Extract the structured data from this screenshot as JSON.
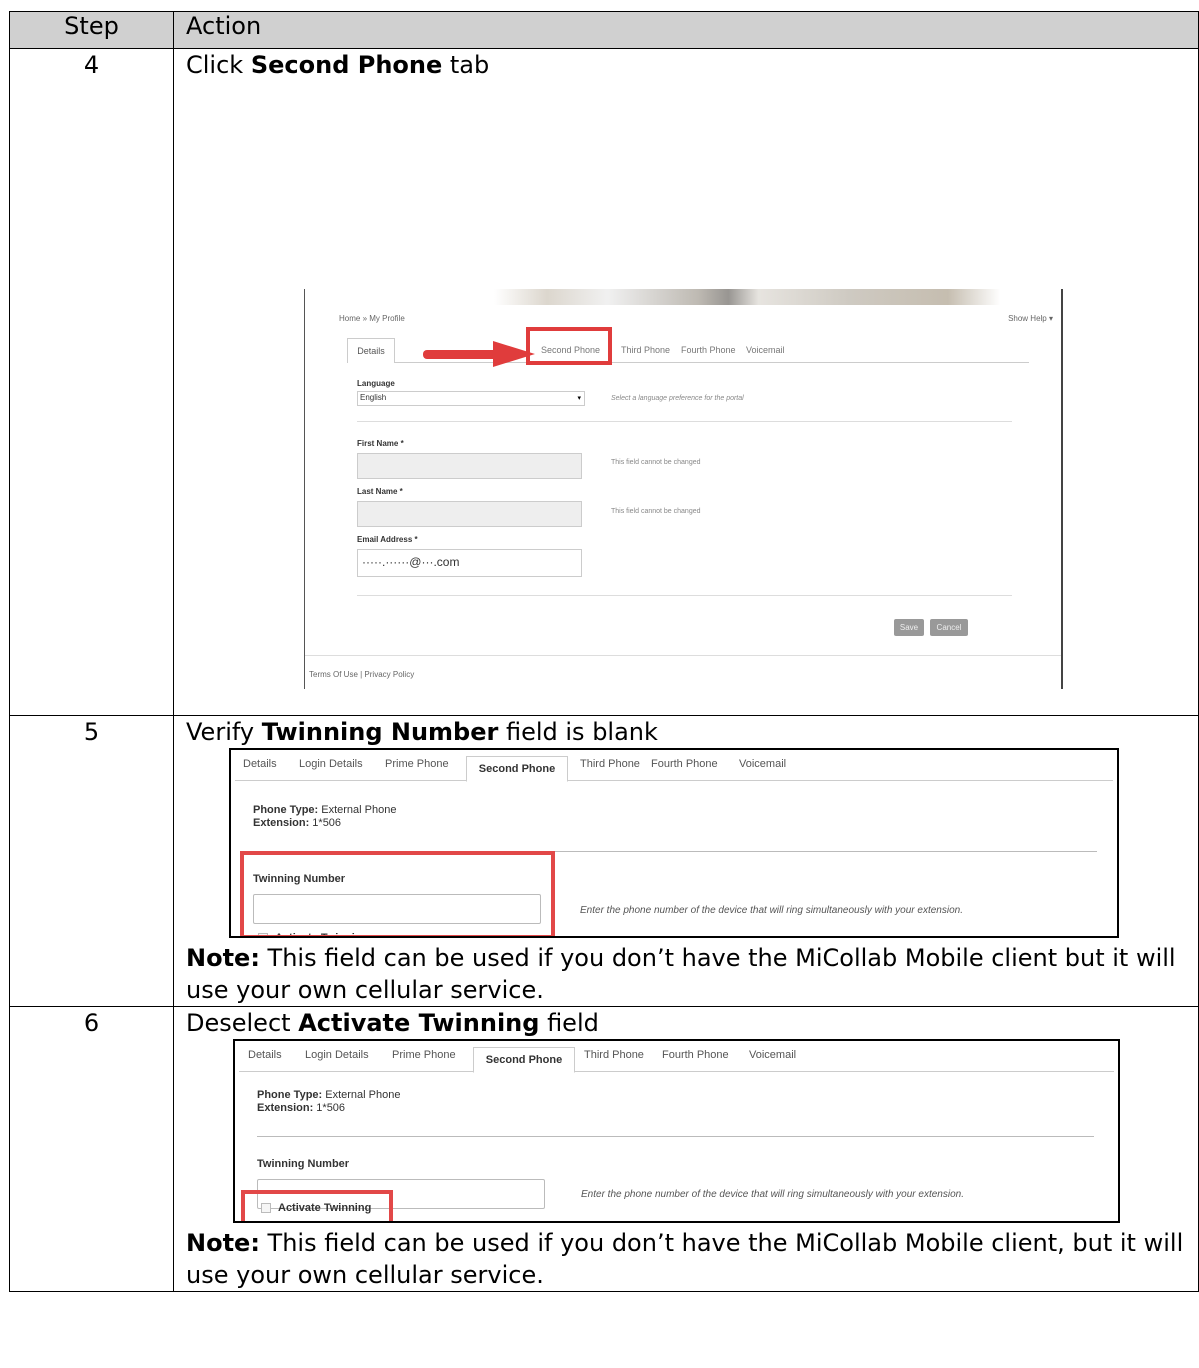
{
  "table": {
    "header": {
      "step": "Step",
      "action": "Action"
    },
    "rows": [
      {
        "step": "4",
        "pre": "Click ",
        "bold": "Second Phone",
        "post": " tab"
      },
      {
        "step": "5",
        "pre": "Verify ",
        "bold": "Twinning Number",
        "post": " field is blank",
        "note_bold": "Note:",
        "note": "  This field can be used if you don’t have the MiCollab Mobile client but it will use your own cellular service."
      },
      {
        "step": "6",
        "pre": "Deselect ",
        "bold": "Activate Twinning",
        "post": " field",
        "note_bold": "Note:",
        "note": "  This field can be used if you don’t have the MiCollab Mobile client, but it will use your own cellular service."
      }
    ]
  },
  "shot1": {
    "breadcrumb": "Home  »  My Profile",
    "show_help": "Show Help ▾",
    "tabs": [
      "Details",
      "Second Phone",
      "Third Phone",
      "Fourth Phone",
      "Voicemail"
    ],
    "language_label": "Language",
    "language_value": "English",
    "language_help": "Select a language preference for the portal",
    "first_name_label": "First Name *",
    "first_name_help": "This field cannot be changed",
    "last_name_label": "Last Name *",
    "last_name_help": "This field cannot be changed",
    "email_label": "Email Address *",
    "email_value": "·····.······@···.com",
    "save": "Save",
    "cancel": "Cancel",
    "footer": "Terms Of Use  |  Privacy Policy",
    "accent_red": "#e03c3c"
  },
  "panel": {
    "tabs": [
      "Details",
      "Login Details",
      "Prime Phone",
      "Second Phone",
      "Third Phone",
      "Fourth Phone",
      "Voicemail"
    ],
    "active_tab": "Second Phone",
    "phone_type_label": "Phone Type:",
    "phone_type_value": " External Phone",
    "extension_label": "Extension:",
    "extension_value": " 1*506",
    "twinning_label": "Twinning Number",
    "twinning_value": "",
    "twinning_hint": "Enter the phone number of the device that will ring simultaneously with your extension.",
    "activate_label": "Activate Twinning",
    "highlight_red": "#e24848"
  }
}
